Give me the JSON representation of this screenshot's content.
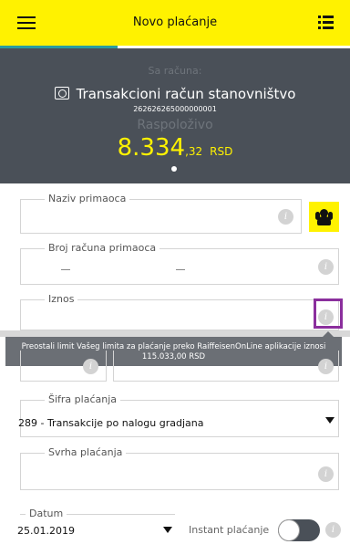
{
  "header": {
    "title": "Novo plaćanje"
  },
  "account": {
    "from_label": "Sa računa:",
    "name": "Transakcioni račun stanovništvo",
    "number": "262626265000000001",
    "available_label": "Raspoloživo",
    "amount_major": "8.334",
    "amount_minor": ",32",
    "currency": "RSD"
  },
  "form": {
    "recipient_name": {
      "label": "Naziv primaoca",
      "value": ""
    },
    "recipient_account": {
      "label": "Broj računa primaoca",
      "part1": "",
      "part2": ""
    },
    "amount": {
      "label": "Iznos",
      "value": ""
    },
    "tooltip": "Preostali limit Vašeg limita za plaćanje preko RaiffeisenOnLine aplikacije iznosi 115.033,00 RSD",
    "payment_code": {
      "label": "Šifra plaćanja",
      "value": "289 - Transakcije po nalogu gradjana"
    },
    "purpose": {
      "label": "Svrha plaćanja",
      "value": ""
    },
    "date": {
      "label": "Datum",
      "value": "25.01.2019"
    },
    "instant": {
      "label": "Instant plaćanje",
      "enabled": false
    }
  },
  "icons": {
    "menu": "menu-icon",
    "list": "list-icon",
    "account": "wallet-icon",
    "info": "info-icon",
    "contacts": "contacts-icon",
    "dropdown": "caret-down-icon"
  },
  "colors": {
    "accent": "#FFF200",
    "header_bg": "#4a5058",
    "tab_indicator": "#2a9d9d",
    "highlight": "#8b2f9d",
    "tooltip_bg": "#6b6f75"
  }
}
